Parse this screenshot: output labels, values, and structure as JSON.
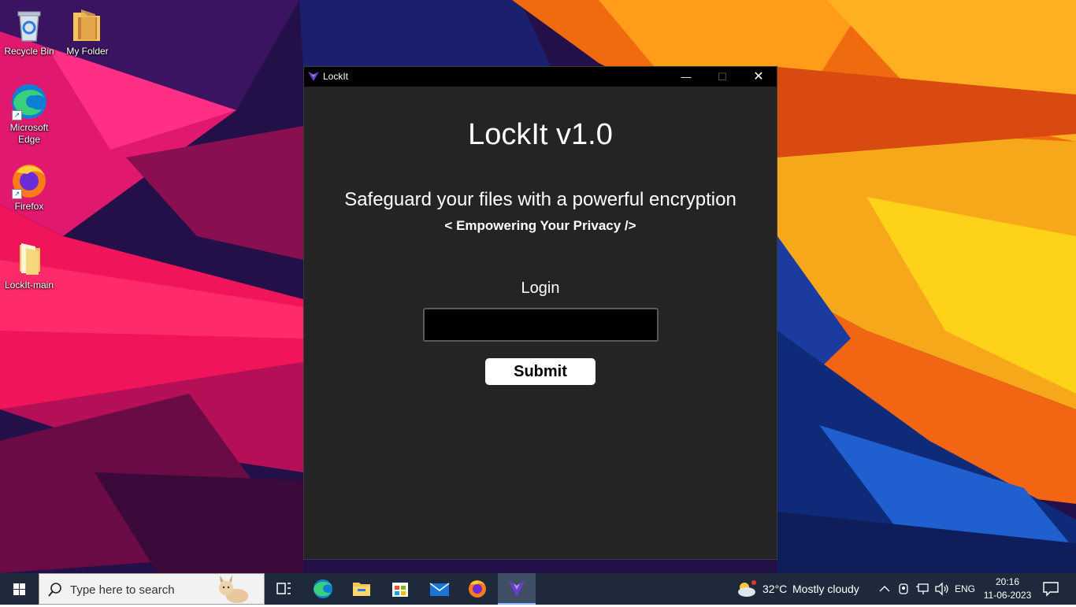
{
  "desktop": {
    "icons": [
      {
        "label": "Recycle Bin"
      },
      {
        "label": "My Folder"
      },
      {
        "label": "Microsoft Edge"
      },
      {
        "label": "Firefox"
      },
      {
        "label": "LockIt-main"
      }
    ]
  },
  "window": {
    "title": "LockIt",
    "controls": {
      "minimize": "—",
      "maximize": "☐",
      "close": "✕"
    }
  },
  "app": {
    "heading": "LockIt v1.0",
    "tagline": "Safeguard your files with a powerful encryption",
    "subtagline": "< Empowering Your Privacy />",
    "login_label": "Login",
    "login_value": "",
    "submit_label": "Submit"
  },
  "taskbar": {
    "search_placeholder": "Type here to search",
    "apps": [
      "task-view",
      "edge",
      "file-explorer",
      "microsoft-store",
      "mail",
      "firefox",
      "lockit"
    ],
    "active_app": "lockit",
    "weather": {
      "temp": "32°C",
      "condition": "Mostly cloudy"
    },
    "language": "ENG",
    "time": "20:16",
    "date": "11-06-2023"
  }
}
